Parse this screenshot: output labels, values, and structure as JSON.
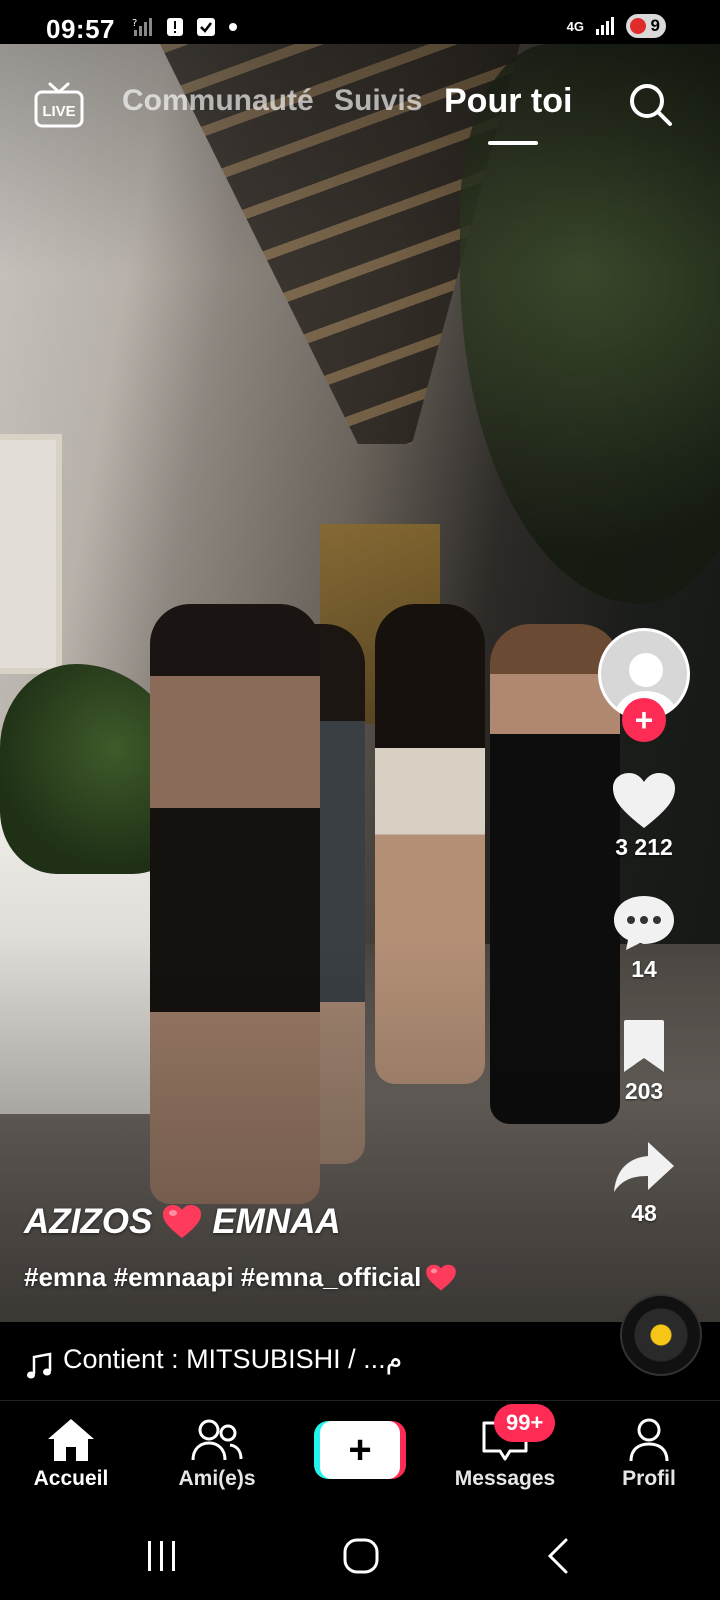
{
  "status_bar": {
    "time": "09:57",
    "battery_level": "9",
    "network_label": "4G"
  },
  "top_nav": {
    "live_label": "LIVE",
    "tabs": [
      {
        "label": "Communauté",
        "active": false
      },
      {
        "label": "Suivis",
        "active": false
      },
      {
        "label": "Pour toi",
        "active": true
      }
    ]
  },
  "actions": {
    "likes": "3 212",
    "comments": "14",
    "saves": "203",
    "shares": "48"
  },
  "caption": {
    "author_part1": "AZIZOS",
    "author_part2": "EMNAA",
    "hashtags": "#emna #emnaapi #emna_official"
  },
  "music": {
    "text": "Contient : MITSUBISHI / ...م"
  },
  "bottom_nav": {
    "home": "Accueil",
    "friends": "Ami(e)s",
    "create": "+",
    "messages": "Messages",
    "messages_badge": "99+",
    "profile": "Profil"
  },
  "colors": {
    "accent_pink": "#fe2c55",
    "accent_cyan": "#25f4ee",
    "heart_emoji": "#ff3b5c"
  }
}
